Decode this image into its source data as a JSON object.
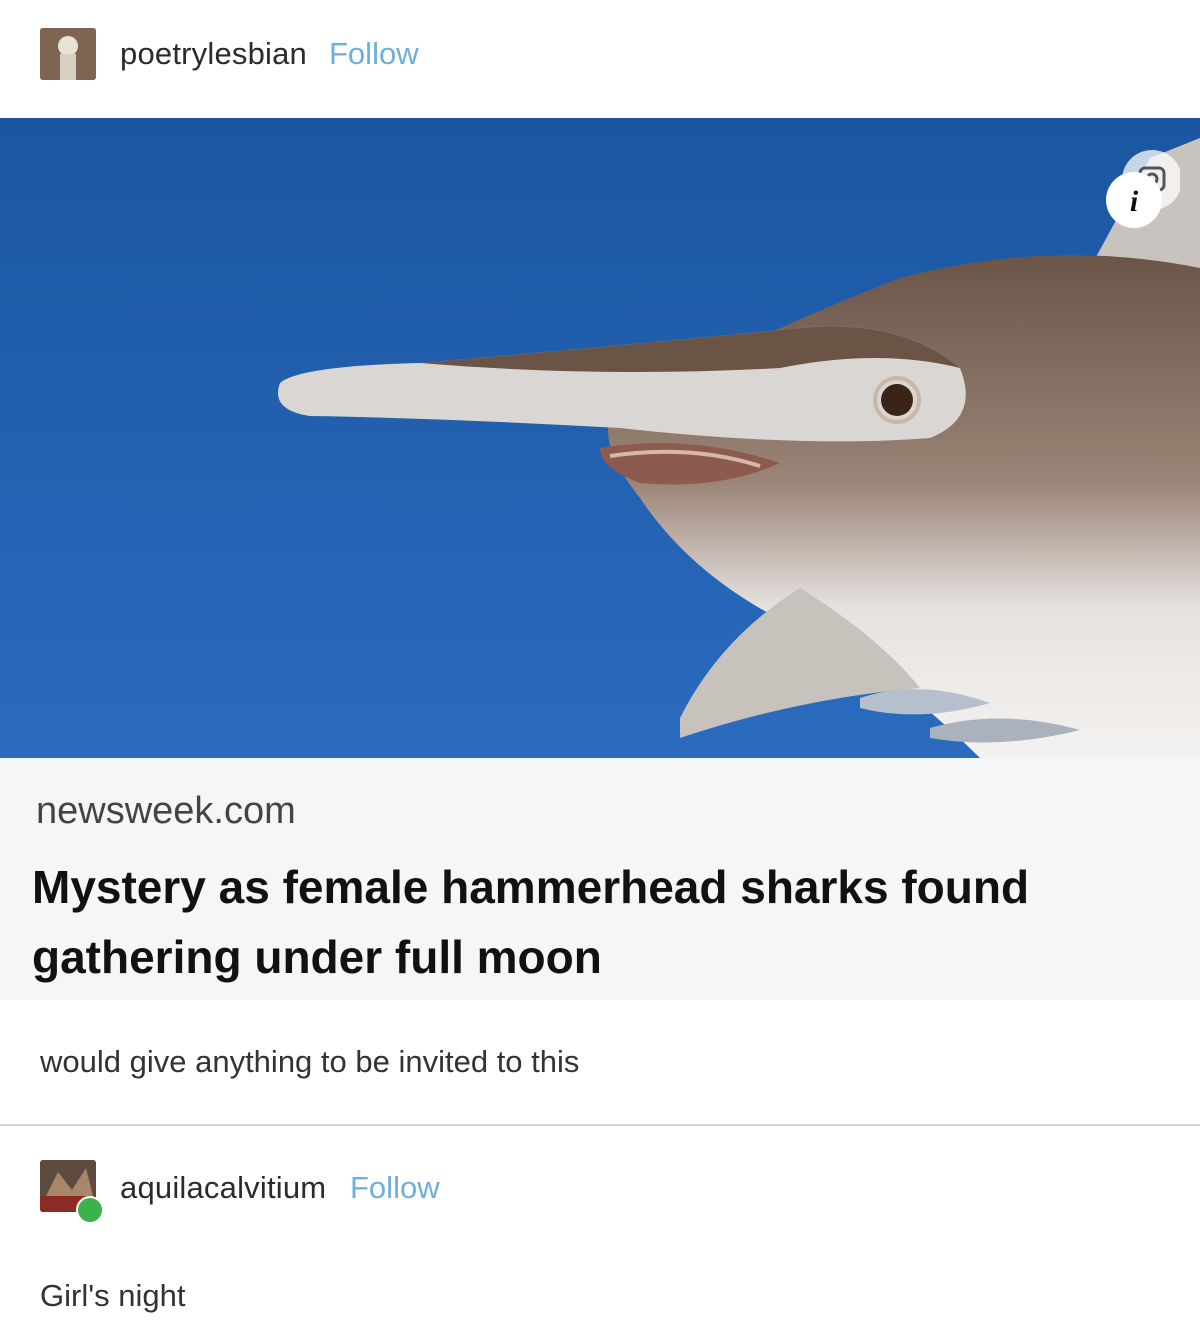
{
  "post": {
    "author": "poetrylesbian",
    "follow_label": "Follow"
  },
  "link_card": {
    "domain": "newsweek.com",
    "title": "Mystery as female hammerhead sharks found gathering under full moon"
  },
  "post_caption": "would give anything to be invited to this",
  "reply": {
    "author": "aquilacalvitium",
    "follow_label": "Follow",
    "text": "Girl's night"
  },
  "icons": {
    "info": "info-icon",
    "visual_search": "visual-search-icon"
  },
  "colors": {
    "follow": "#6fb0d8",
    "ocean": "#1d5fa8",
    "card_bg": "#f4f6f8"
  }
}
